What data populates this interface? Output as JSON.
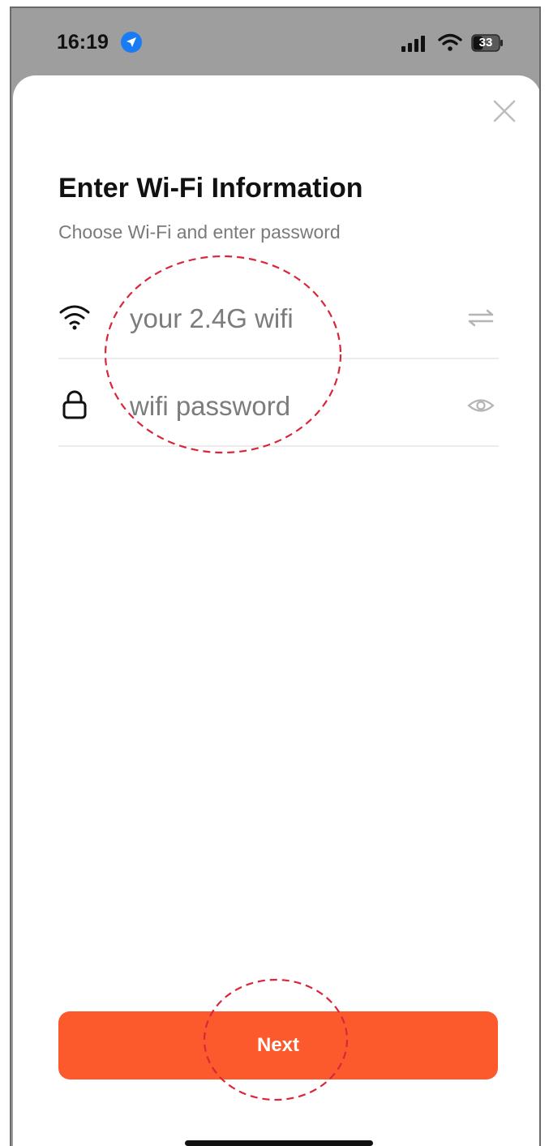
{
  "status_bar": {
    "time": "16:19",
    "battery": "33",
    "icons": [
      "location-arrow-icon",
      "cellular-signal-icon",
      "wifi-icon",
      "battery-icon"
    ]
  },
  "sheet": {
    "title": "Enter Wi-Fi Information",
    "subtitle": "Choose Wi-Fi and enter password",
    "wifi_field": {
      "value": "",
      "placeholder": "your 2.4G wifi",
      "icon": "wifi-icon",
      "action_icon": "swap-arrows-icon"
    },
    "password_field": {
      "value": "",
      "placeholder": "wifi password",
      "icon": "lock-icon",
      "action_icon": "eye-icon"
    },
    "next_label": "Next"
  },
  "colors": {
    "accent": "#fc5a2c",
    "location_blue": "#1a7cf5",
    "annotation_red": "#d9263b"
  }
}
